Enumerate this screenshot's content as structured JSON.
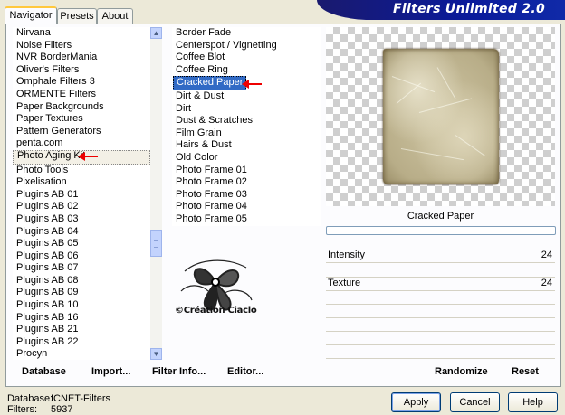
{
  "app": {
    "title": "Filters Unlimited 2.0"
  },
  "tabs": [
    "Navigator",
    "Presets",
    "About"
  ],
  "categories": [
    "Nirvana",
    "Noise Filters",
    "NVR BorderMania",
    "Oliver's Filters",
    "Omphale Filters 3",
    "ORMENTE Filters",
    "Paper Backgrounds",
    "Paper Textures",
    "Pattern Generators",
    "penta.com",
    "Photo Aging Kit",
    "Photo Tools",
    "Pixelisation",
    "Plugins AB 01",
    "Plugins AB 02",
    "Plugins AB 03",
    "Plugins AB 04",
    "Plugins AB 05",
    "Plugins AB 06",
    "Plugins AB 07",
    "Plugins AB 08",
    "Plugins AB 09",
    "Plugins AB 10",
    "Plugins AB 16",
    "Plugins AB 21",
    "Plugins AB 22",
    "Procyn"
  ],
  "selected_category": "Photo Aging Kit",
  "filters": [
    "Border Fade",
    "Centerspot / Vignetting",
    "Coffee Blot",
    "Coffee Ring",
    "Cracked Paper",
    "Dirt & Dust",
    "Dirt",
    "Dust & Scratches",
    "Film Grain",
    "Hairs & Dust",
    "Old Color",
    "Photo Frame 01",
    "Photo Frame 02",
    "Photo Frame 03",
    "Photo Frame 04",
    "Photo Frame 05"
  ],
  "selected_filter": "Cracked Paper",
  "watermark": "©Création Ciaclo",
  "preview": {
    "filter_name": "Cracked Paper"
  },
  "params": [
    {
      "label": "Intensity",
      "value": "24"
    },
    {
      "label": "Texture",
      "value": "24"
    }
  ],
  "panel_buttons": {
    "database": "Database",
    "import": "Import...",
    "filter_info": "Filter Info...",
    "editor": "Editor...",
    "randomize": "Randomize",
    "reset": "Reset"
  },
  "status": {
    "database_label": "Database:",
    "database_value": "ICNET-Filters",
    "filters_label": "Filters:",
    "filters_value": "5937"
  },
  "dialog_buttons": {
    "apply": "Apply",
    "cancel": "Cancel",
    "help": "Help"
  }
}
